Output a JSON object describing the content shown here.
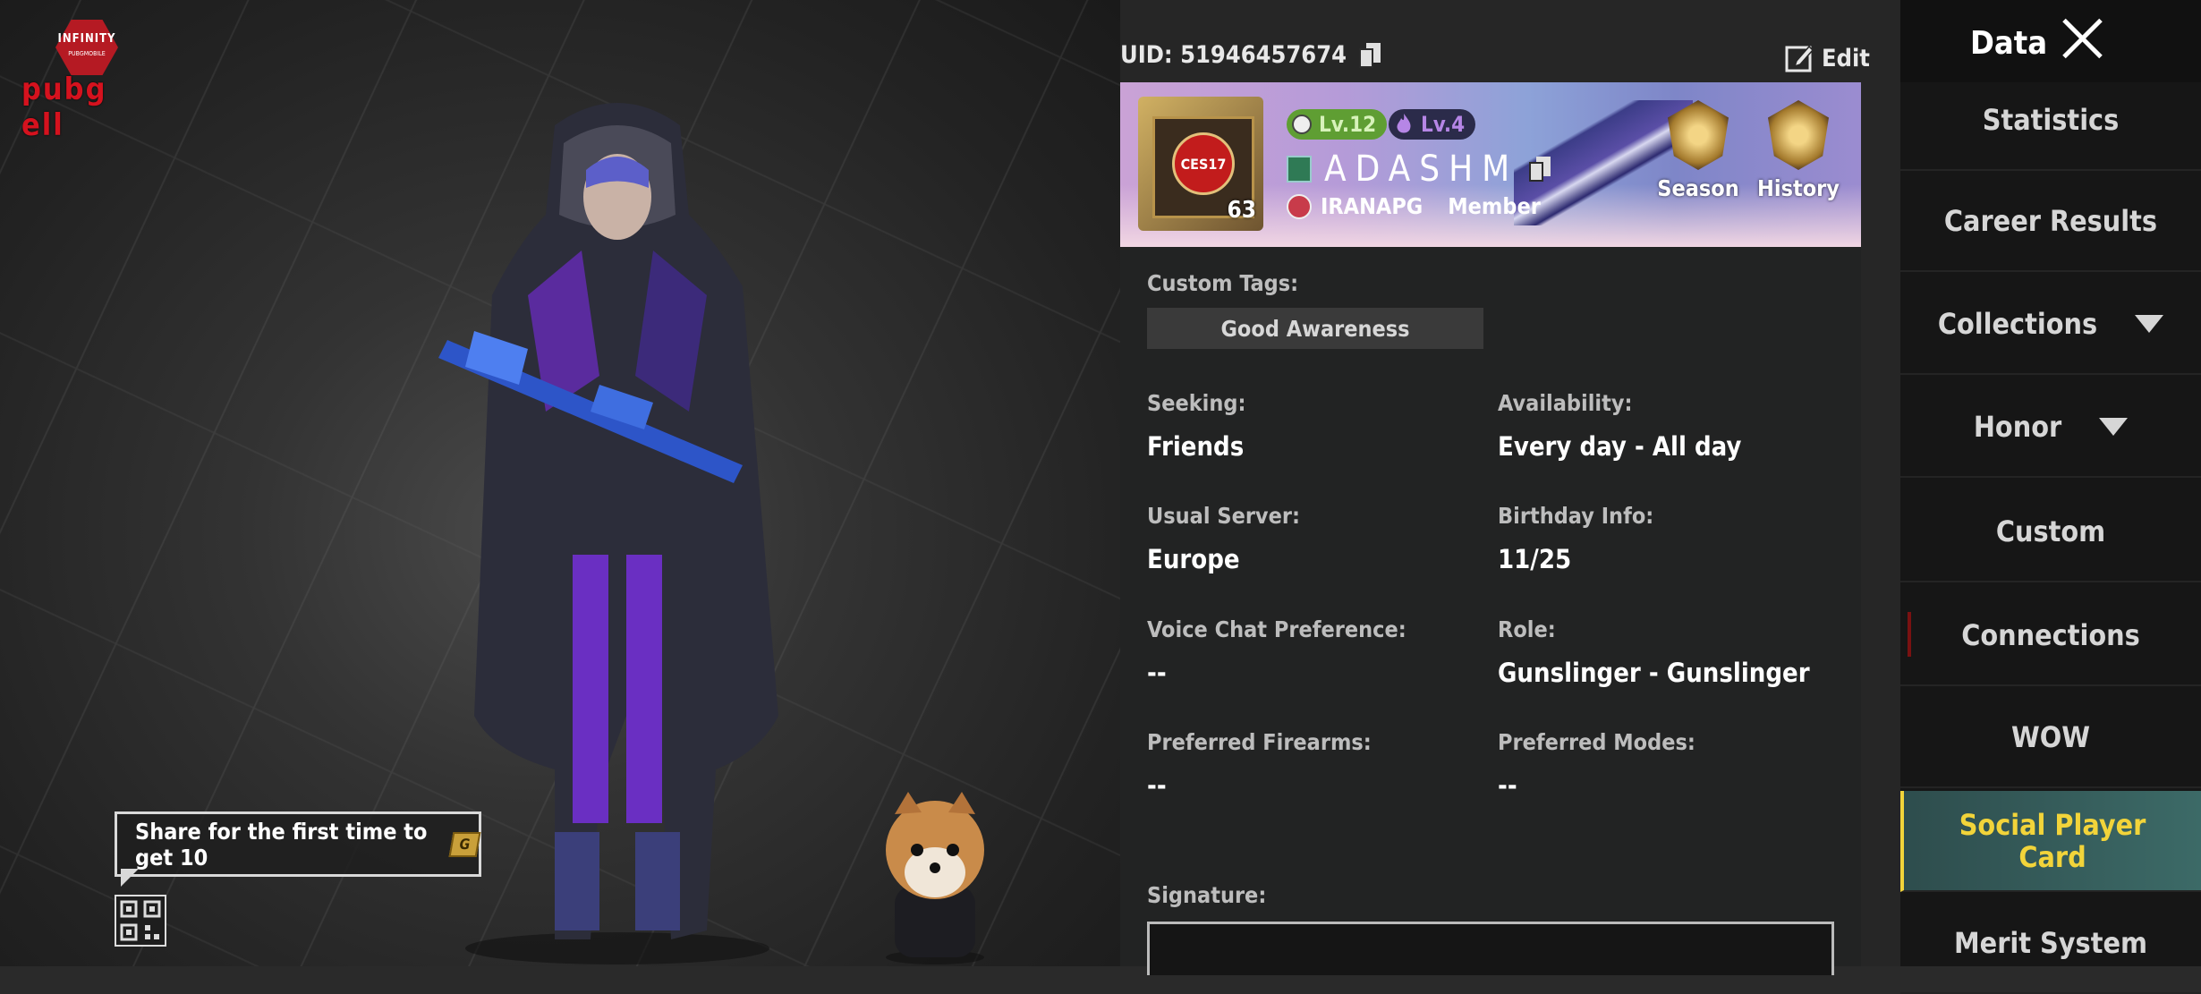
{
  "header": {
    "uid": "UID: 51946457674",
    "edit_label": "Edit"
  },
  "logo": {
    "top": "INFINITY",
    "sub": "PUBGMOBILE",
    "word": "pubg ell"
  },
  "share": {
    "text": "Share for the first time to get 10",
    "coin": "G"
  },
  "profile": {
    "frame_label": "CES17",
    "frame_level": "63",
    "level_badge": "Lv.12",
    "tier_badge": "Lv.4",
    "player_name": "ADASHM",
    "clan_name": "IRANAPG",
    "clan_role": "Member",
    "season_label": "Season",
    "history_label": "History"
  },
  "details": {
    "custom_tags_label": "Custom Tags:",
    "custom_tag": "Good Awareness",
    "seeking_label": "Seeking:",
    "seeking_value": "Friends",
    "availability_label": "Availability:",
    "availability_value": "Every day - All day",
    "server_label": "Usual Server:",
    "server_value": "Europe",
    "birthday_label": "Birthday Info:",
    "birthday_value": "11/25",
    "voice_label": "Voice Chat Preference:",
    "voice_value": "--",
    "role_label": "Role:",
    "role_value": "Gunslinger - Gunslinger",
    "firearms_label": "Preferred Firearms:",
    "firearms_value": "--",
    "modes_label": "Preferred Modes:",
    "modes_value": "--",
    "signature_label": "Signature:"
  },
  "menu": {
    "title": "Data",
    "items": [
      {
        "label": "Statistics"
      },
      {
        "label": "Career Results"
      },
      {
        "label": "Collections"
      },
      {
        "label": "Honor"
      },
      {
        "label": "Custom"
      },
      {
        "label": "Connections"
      },
      {
        "label": "WOW"
      },
      {
        "label_line1": "Social Player",
        "label_line2": "Card"
      },
      {
        "label": "Merit System"
      }
    ]
  },
  "colors": {
    "accent": "#f2d43a",
    "panel": "#222323",
    "menu": "#161616",
    "active_bg": "#3c6a67"
  }
}
